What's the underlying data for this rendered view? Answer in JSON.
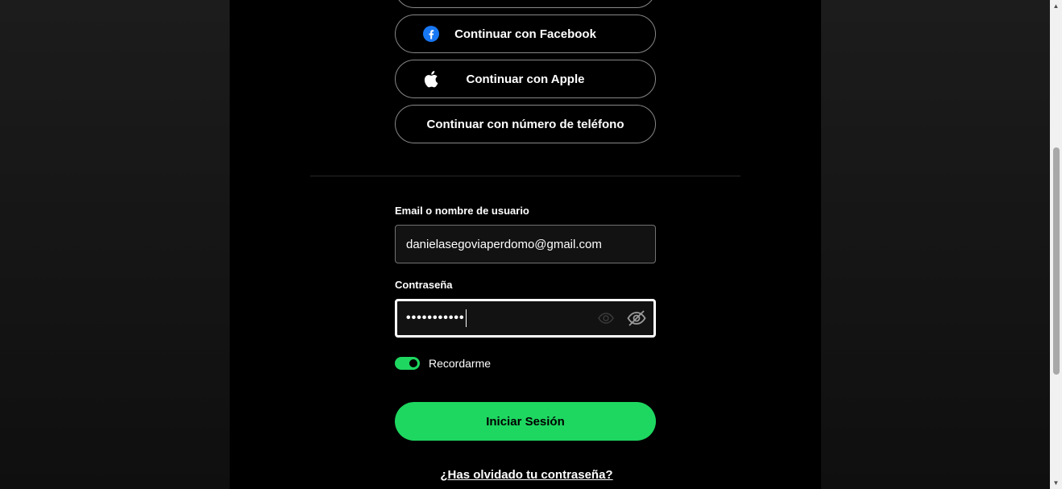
{
  "social": {
    "partial_label": "",
    "facebook_label": "Continuar con Facebook",
    "apple_label": "Continuar con Apple",
    "phone_label": "Continuar con número de teléfono"
  },
  "form": {
    "email_label": "Email o nombre de usuario",
    "email_value": "danielasegoviaperdomo@gmail.com",
    "password_label": "Contraseña",
    "password_value": "•••••••••••",
    "remember_label": "Recordarme",
    "remember_checked": true,
    "login_label": "Iniciar Sesión",
    "forgot_label": "¿Has olvidado tu contraseña?"
  },
  "colors": {
    "accent": "#1ed760",
    "facebook": "#1877f2",
    "background": "#000000"
  },
  "icons": {
    "facebook": "facebook-icon",
    "apple": "apple-icon",
    "eye": "eye-icon",
    "eye_off": "eye-off-icon"
  }
}
